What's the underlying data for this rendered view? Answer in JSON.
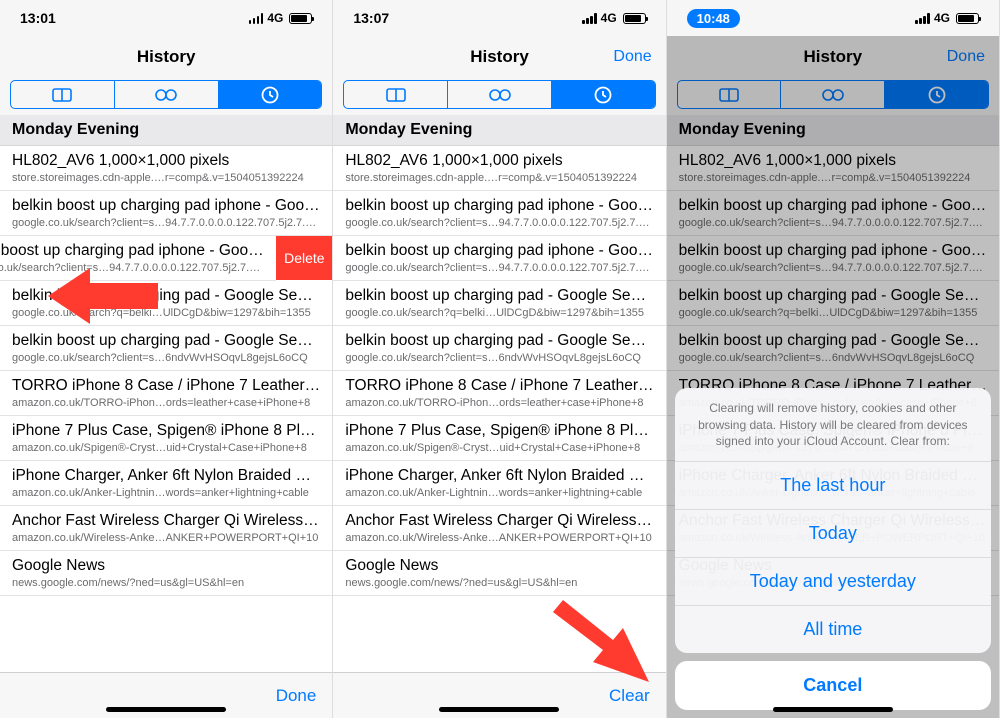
{
  "phones": [
    {
      "time": "13:01",
      "time_pill": false,
      "network": "4G",
      "title": "History",
      "nav_right": "",
      "toolbar": "Done",
      "swiped_index": 2,
      "delete_label": "Delete"
    },
    {
      "time": "13:07",
      "time_pill": false,
      "network": "4G",
      "title": "History",
      "nav_right": "Done",
      "toolbar": "Clear",
      "swiped_index": -1
    },
    {
      "time": "10:48",
      "time_pill": true,
      "network": "4G",
      "title": "History",
      "nav_right": "Done",
      "toolbar": "",
      "swiped_index": -1,
      "sheet": {
        "message": "Clearing will remove history, cookies and other browsing data. History will be cleared from devices signed into your iCloud Account. Clear from:",
        "options": [
          "The last hour",
          "Today",
          "Today and yesterday",
          "All time"
        ],
        "cancel": "Cancel"
      }
    }
  ],
  "section_header": "Monday Evening",
  "rows": [
    {
      "title": "HL802_AV6 1,000×1,000 pixels",
      "url": "store.storeimages.cdn-apple.…r=comp&.v=1504051392224"
    },
    {
      "title": "belkin boost up charging pad iphone - Goo…",
      "url": "google.co.uk/search?client=s…94.7.7.0.0.0.0.122.707.5j2.7.0.…"
    },
    {
      "title": "belkin boost up charging pad iphone - Goo…",
      "url": "google.co.uk/search?client=s…94.7.7.0.0.0.0.122.707.5j2.7.0.…"
    },
    {
      "title": "belkin boost up charging pad - Google Sea…",
      "url": "google.co.uk/search?q=belki…UlDCgD&biw=1297&bih=1355"
    },
    {
      "title": "belkin boost up charging pad - Google Sea…",
      "url": "google.co.uk/search?client=s…6ndvWvHSOqvL8gejsL6oCQ"
    },
    {
      "title": "TORRO iPhone 8 Case / iPhone 7 Leather…",
      "url": "amazon.co.uk/TORRO-iPhon…ords=leather+case+iPhone+8"
    },
    {
      "title": "iPhone 7 Plus Case, Spigen® iPhone 8 Plus…",
      "url": "amazon.co.uk/Spigen®-Cryst…uid+Crystal+Case+iPhone+8"
    },
    {
      "title": "iPhone Charger, Anker 6ft Nylon Braided U…",
      "url": "amazon.co.uk/Anker-Lightnin…words=anker+lightning+cable"
    },
    {
      "title": "Anchor Fast Wireless Charger Qi Wireless I…",
      "url": "amazon.co.uk/Wireless-Anke…ANKER+POWERPORT+QI+10"
    },
    {
      "title": "Google News",
      "url": "news.google.com/news/?ned=us&gl=US&hl=en"
    }
  ]
}
